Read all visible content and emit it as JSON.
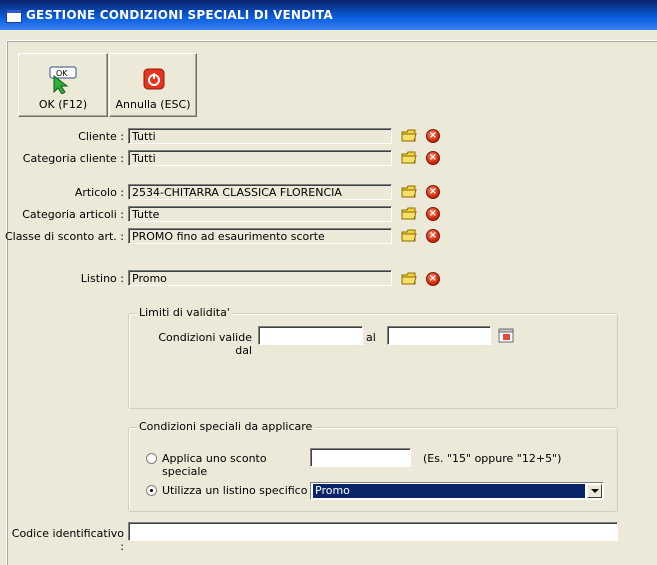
{
  "window": {
    "title": "GESTIONE CONDIZIONI SPECIALI DI VENDITA"
  },
  "toolbar": {
    "ok": {
      "label": "OK (F12)",
      "icon": "ok-check-icon",
      "icon_text": "OK"
    },
    "cancel": {
      "label": "Annulla (ESC)",
      "icon": "power-off-icon"
    }
  },
  "filters": [
    {
      "label": "Cliente :",
      "value": "Tutti"
    },
    {
      "label": "Categoria cliente :",
      "value": "Tutti"
    },
    {
      "label": "Articolo :",
      "value": "2534-CHITARRA CLASSICA FLORENCIA"
    },
    {
      "label": "Categoria articoli :",
      "value": "Tutte"
    },
    {
      "label": "Classe di sconto art. :",
      "value": "PROMO fino ad esaurimento scorte"
    },
    {
      "label": "Listino :",
      "value": "Promo"
    }
  ],
  "validity": {
    "group_title": "Limiti di validita'",
    "from_label": "Condizioni valide dal",
    "from_value": "",
    "to_label": "al",
    "to_value": ""
  },
  "conditions": {
    "group_title": "Condizioni speciali da applicare",
    "option_discount": {
      "label": "Applica uno sconto speciale",
      "selected": false,
      "value": "",
      "hint": "(Es. \"15\" oppure \"12+5\")"
    },
    "option_pricelist": {
      "label": "Utilizza un listino specifico",
      "selected": true,
      "selected_value": "Promo"
    }
  },
  "identifier": {
    "label": "Codice identificativo :",
    "value": ""
  },
  "colors": {
    "title_bar": "#0A5FE0",
    "face": "#ECE9D8",
    "selection": "#0A246A",
    "delete_red": "#d2290c",
    "folder_yellow": "#f2d23a"
  }
}
